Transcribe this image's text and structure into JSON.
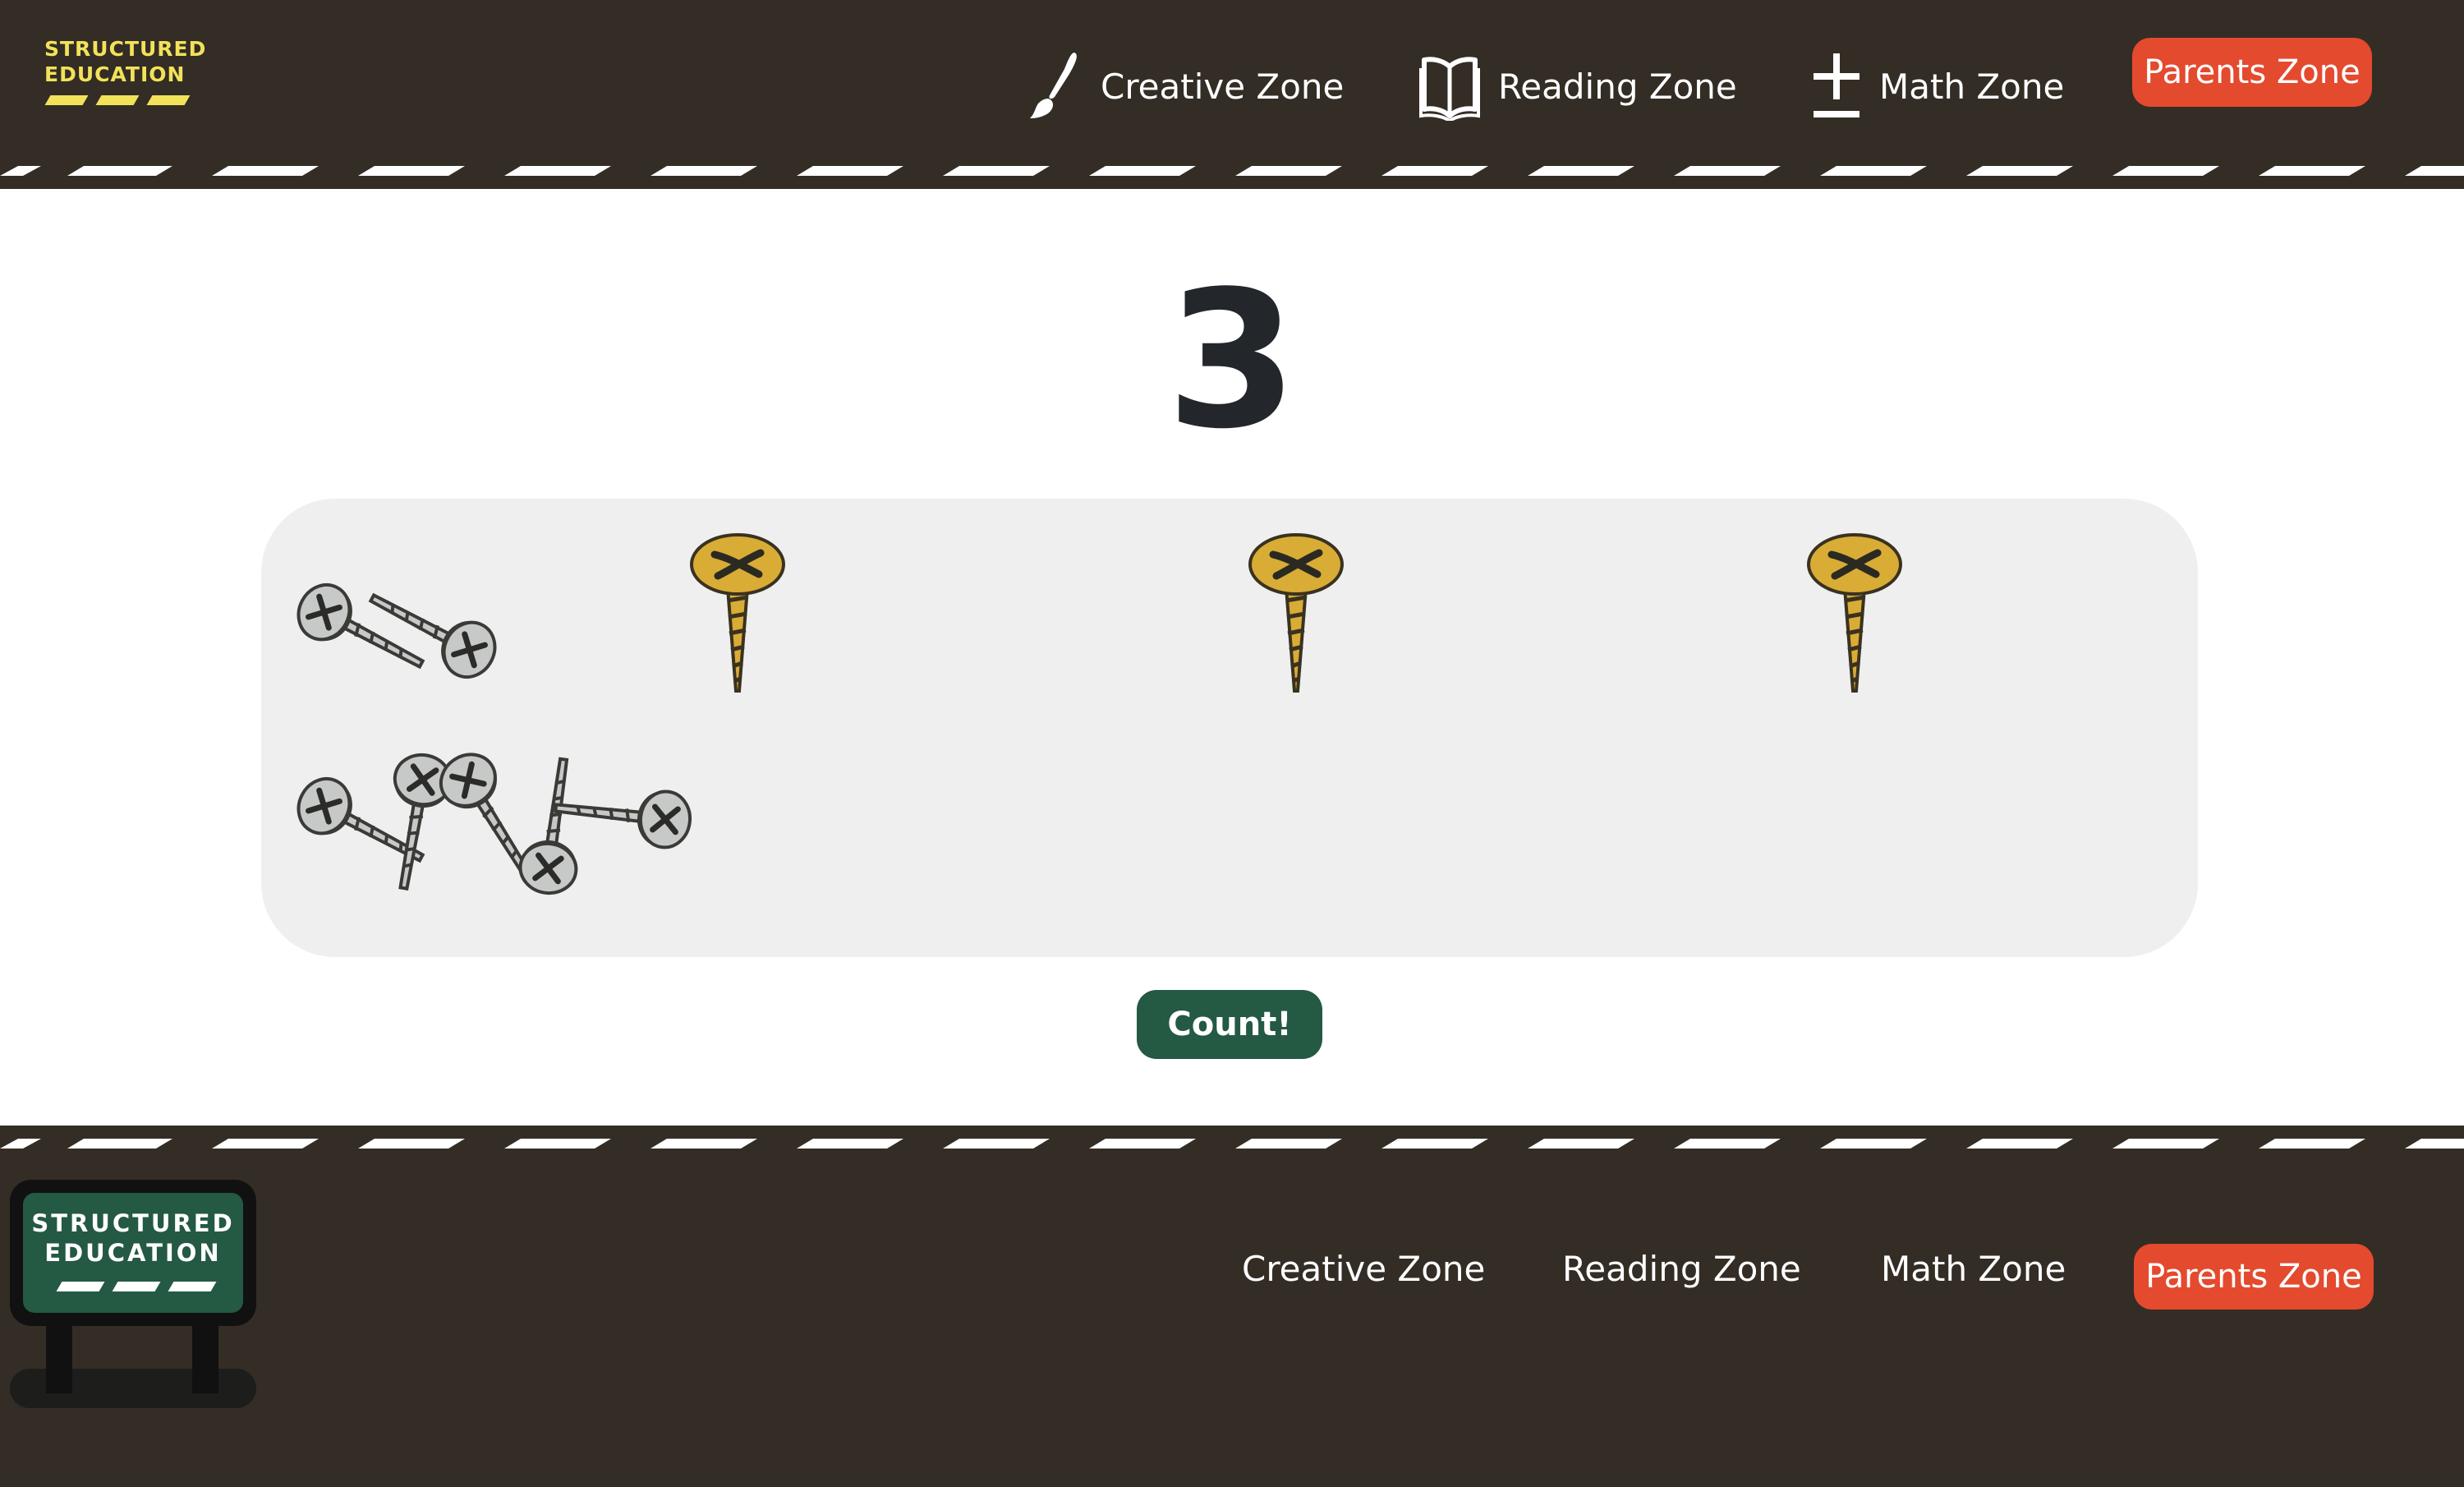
{
  "brand": {
    "line1": "STRUCTURED",
    "line2": "EDUCATION",
    "accent_color": "#f2e25a",
    "sign_color": "#245944"
  },
  "nav": {
    "creative": {
      "label": "Creative Zone",
      "icon": "paintbrush-icon"
    },
    "reading": {
      "label": "Reading Zone",
      "icon": "open-book-icon"
    },
    "math": {
      "label": "Math Zone",
      "icon": "plus-minus-icon"
    },
    "parents": {
      "label": "Parents Zone"
    }
  },
  "activity": {
    "target_number": "3",
    "gold_screws_count": 3,
    "loose_screws_count": 7,
    "count_button_label": "Count!"
  },
  "footer": {
    "brand_line1": "STRUCTURED",
    "brand_line2": "EDUCATION",
    "links": [
      "Creative Zone",
      "Reading Zone",
      "Math Zone"
    ],
    "parents_label": "Parents Zone"
  },
  "colors": {
    "background": "#332d25",
    "parents_button": "#e44a2e",
    "count_button": "#245944",
    "gold_screw": "#d9ac36",
    "silver_screw": "#c7c9c8"
  }
}
